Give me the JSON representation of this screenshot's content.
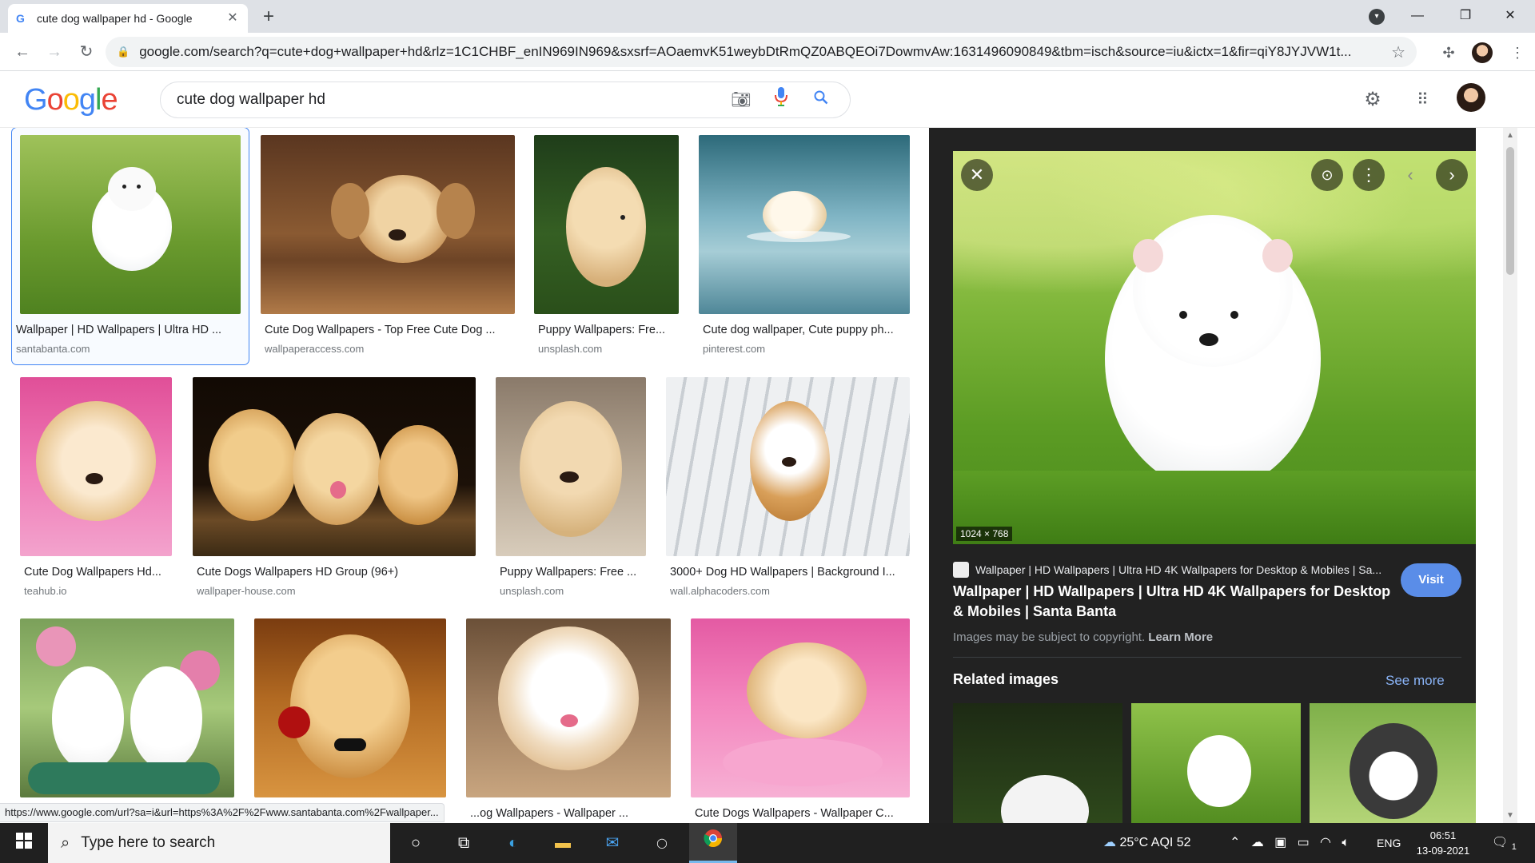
{
  "browser": {
    "tab_title": "cute dog wallpaper hd - Google",
    "tab_icon": "google-g-icon",
    "url": "google.com/search?q=cute+dog+wallpaper+hd&rlz=1C1CHBF_enIN969IN969&sxsrf=AOaemvK51weybDtRmQZ0ABQEOi7DowmvAw:1631496090849&tbm=isch&source=iu&ictx=1&fir=qiY8JYJVW1t...",
    "status_url": "https://www.google.com/url?sa=i&url=https%3A%2F%2Fwww.santabanta.com%2Fwallpaper..."
  },
  "google": {
    "logo_letters": [
      "G",
      "o",
      "o",
      "g",
      "l",
      "e"
    ],
    "logo_colors": [
      "#4285F4",
      "#EA4335",
      "#FBBC05",
      "#4285F4",
      "#34A853",
      "#EA4335"
    ],
    "query": "cute dog wallpaper hd"
  },
  "results": [
    {
      "caption": "Wallpaper | HD Wallpapers | Ultra HD ...",
      "source": "santabanta.com",
      "selected": true
    },
    {
      "caption": "Cute Dog Wallpapers - Top Free Cute Dog ...",
      "source": "wallpaperaccess.com"
    },
    {
      "caption": "Puppy Wallpapers: Fre...",
      "source": "unsplash.com"
    },
    {
      "caption": "Cute dog wallpaper, Cute puppy ph...",
      "source": "pinterest.com"
    },
    {
      "caption": "Cute Dog Wallpapers Hd...",
      "source": "teahub.io"
    },
    {
      "caption": "Cute Dogs Wallpapers HD Group (96+)",
      "source": "wallpaper-house.com"
    },
    {
      "caption": "Puppy Wallpapers: Free ...",
      "source": "unsplash.com"
    },
    {
      "caption": "3000+ Dog HD Wallpapers | Background I...",
      "source": "wall.alphacoders.com"
    },
    {
      "caption": "",
      "source": ""
    },
    {
      "caption": "",
      "source": ""
    },
    {
      "caption": "...og Wallpapers - Wallpaper ...",
      "source": ""
    },
    {
      "caption": "Cute Dogs Wallpapers - Wallpaper C...",
      "source": ""
    }
  ],
  "panel": {
    "dimensions": "1024 × 768",
    "source_line": "Wallpaper | HD Wallpapers | Ultra HD 4K Wallpapers for Desktop & Mobiles | Sa...",
    "title": "Wallpaper | HD Wallpapers | Ultra HD 4K Wallpapers for Desktop & Mobiles | Santa Banta",
    "visit_label": "Visit",
    "copyright_text": "Images may be subject to copyright.",
    "learn_more": "Learn More",
    "related_heading": "Related images",
    "see_more": "See more"
  },
  "taskbar": {
    "search_placeholder": "Type here to search",
    "weather": "25°C  AQI 52",
    "language": "ENG",
    "time": "06:51",
    "date": "13-09-2021",
    "notification_count": "1"
  },
  "colors": {
    "panel_bg": "#222222",
    "visit_button": "#5A8DE8",
    "link_blue": "#8AB4F8",
    "taskbar": "#202020"
  }
}
